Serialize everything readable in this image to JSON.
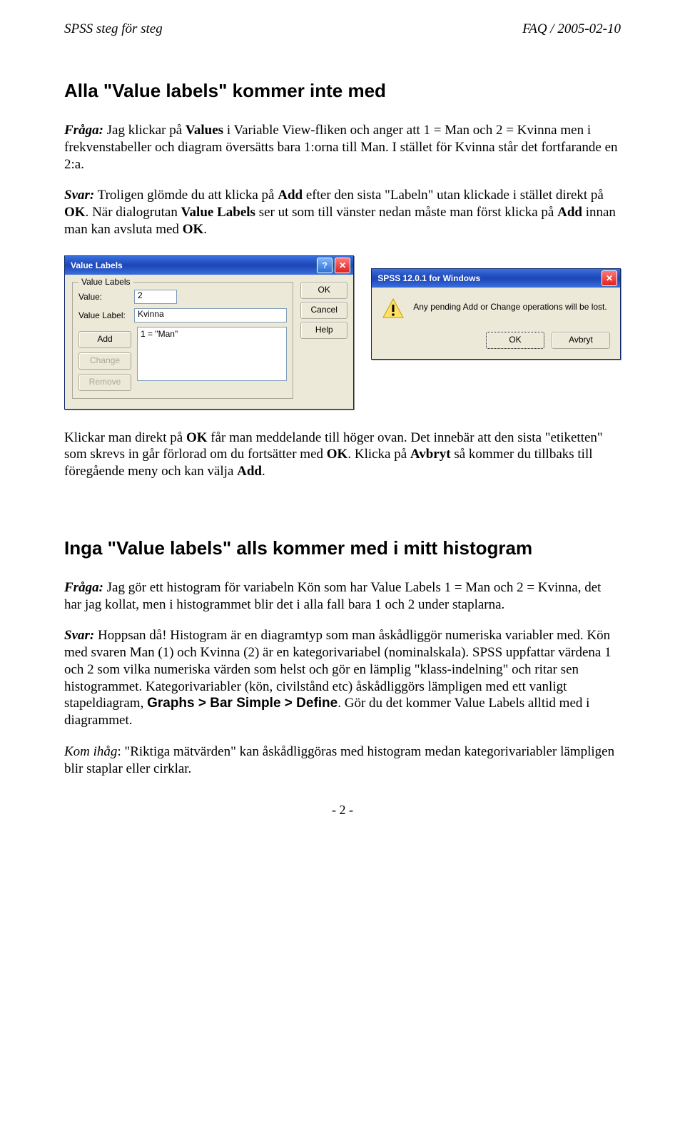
{
  "header": {
    "left": "SPSS steg för steg",
    "right": "FAQ / 2005-02-10"
  },
  "section1": {
    "title": "Alla \"Value labels\" kommer inte med",
    "p1_html": "<i><b>Fråga:</b></i> Jag klickar på <b>Values</b> i Variable View-fliken och anger att 1 = Man och 2 = Kvinna men i frekvenstabeller och diagram översätts bara 1:orna till Man. I stället för Kvinna står det fortfarande en 2:a.",
    "p2_html": "<i><b>Svar:</b></i> Troligen glömde du att klicka på <b>Add</b> efter den sista \"Labeln\" utan klickade i stället direkt på <b>OK</b>. När dialogrutan <b>Value Labels</b> ser ut som till vänster nedan måste man först klicka på <b>Add</b> innan man kan avsluta med <b>OK</b>.",
    "p3_html": "Klickar man direkt på <b>OK</b> får man meddelande till höger ovan. Det innebär att den sista \"etiketten\" som skrevs in går förlorad om du fortsätter med <b>OK</b>. Klicka på <b>Avbryt</b> så kommer du tillbaks till föregående meny och kan välja <b>Add</b>."
  },
  "dlg_value_labels": {
    "title": "Value Labels",
    "group_legend": "Value Labels",
    "lbl_value": "Value:",
    "val_value": "2",
    "lbl_label": "Value Label:",
    "val_label": "Kvinna",
    "btn_add": "Add",
    "btn_change": "Change",
    "btn_remove": "Remove",
    "list_item": "1 = \"Man\"",
    "btn_ok": "OK",
    "btn_cancel": "Cancel",
    "btn_help": "Help"
  },
  "dlg_alert": {
    "title": "SPSS 12.0.1 for Windows",
    "msg": "Any pending Add or Change operations will be lost.",
    "btn_ok": "OK",
    "btn_cancel": "Avbryt"
  },
  "section2": {
    "title": "Inga \"Value labels\" alls kommer med i mitt histogram",
    "p1_html": "<i><b>Fråga:</b></i> Jag gör ett histogram för variabeln Kön som har Value Labels 1 = Man och 2 = Kvinna, det har jag kollat, men i histogrammet blir det i alla fall bara 1 och 2 under staplarna.",
    "p2_html": "<i><b>Svar:</b></i> Hoppsan då! Histogram är en diagramtyp som man åskådliggör numeriska variabler med. Kön med svaren Man (1) och Kvinna (2) är en kategorivariabel (nominalskala). SPSS uppfattar värdena 1 och 2 som vilka numeriska värden som helst och gör en lämplig \"klass-indelning\" och ritar sen histogrammet. Kategorivariabler (kön, civilstånd etc) åskådliggörs lämpligen med ett vanligt stapeldiagram, <span class=\"sans\"><b>Graphs &gt; Bar Simple &gt; Define</b></span>. Gör du det kommer Value Labels alltid med i diagrammet.",
    "p3_html": "<i>Kom ihåg</i>: \"Riktiga mätvärden\" kan åskådliggöras med histogram medan kategorivariabler lämpligen blir staplar eller cirklar."
  },
  "page_number": "- 2 -"
}
